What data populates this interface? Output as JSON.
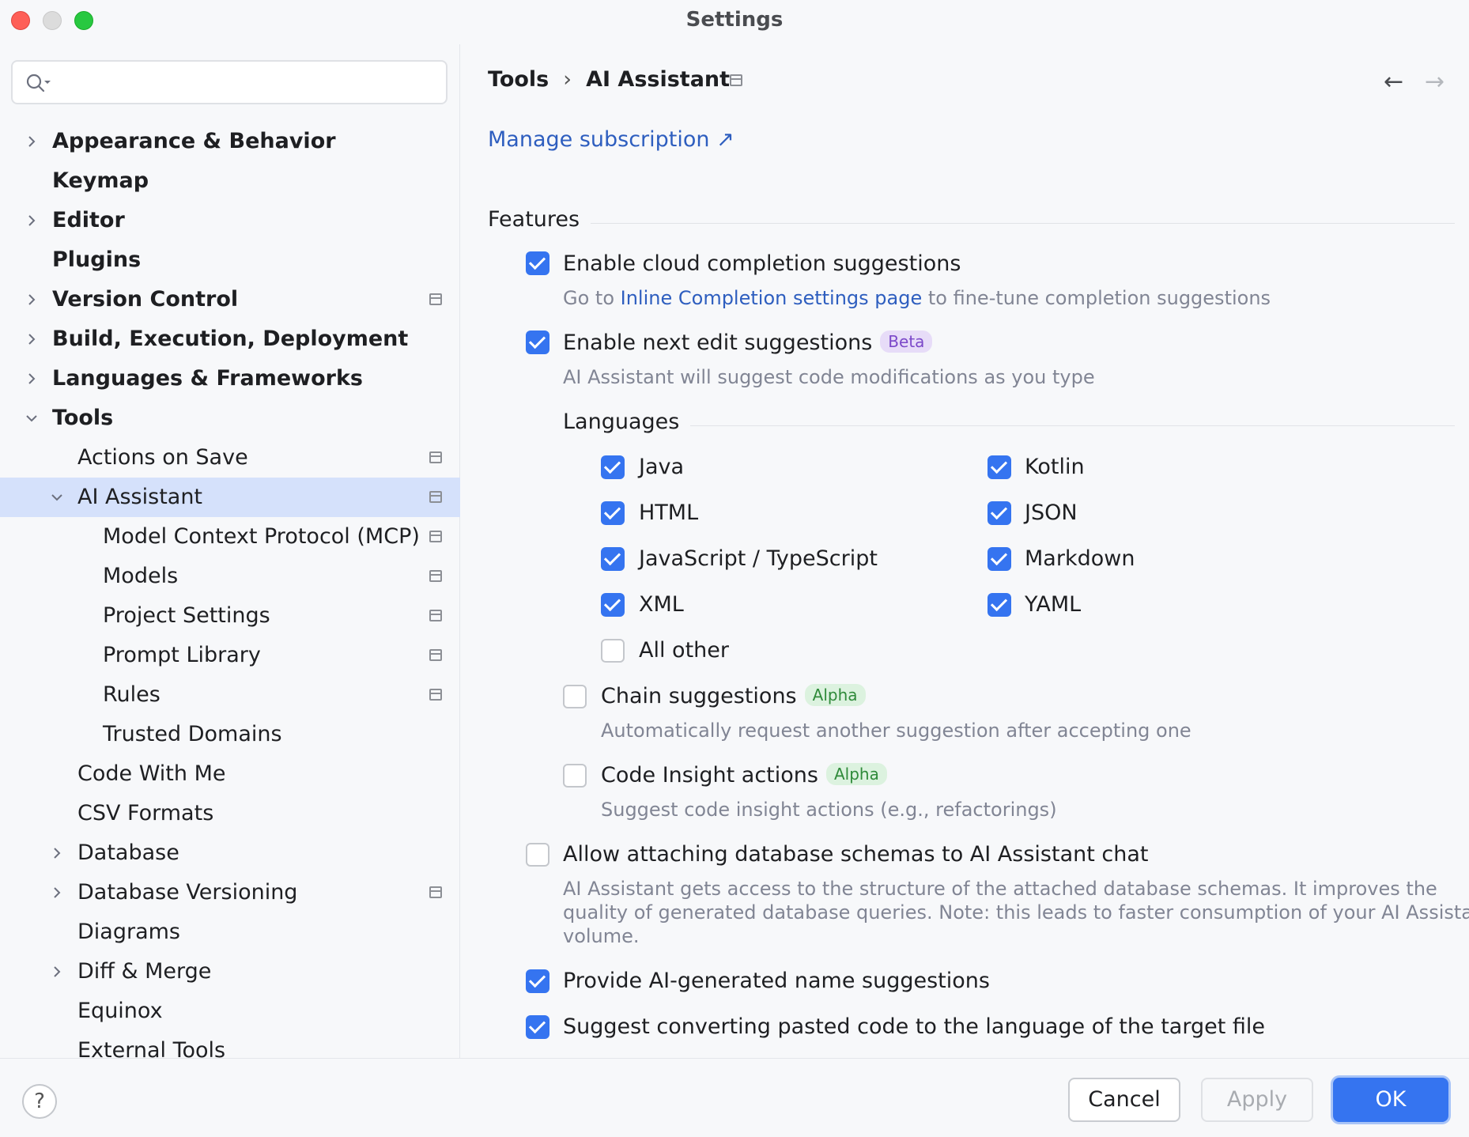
{
  "window": {
    "title": "Settings"
  },
  "sidebar": {
    "search_placeholder": "",
    "items": [
      {
        "label": "Appearance & Behavior",
        "bold": true,
        "level": 0,
        "chevron": "right",
        "pin": false
      },
      {
        "label": "Keymap",
        "bold": true,
        "level": 0,
        "chevron": "none",
        "pin": false
      },
      {
        "label": "Editor",
        "bold": true,
        "level": 0,
        "chevron": "right",
        "pin": false
      },
      {
        "label": "Plugins",
        "bold": true,
        "level": 0,
        "chevron": "none",
        "pin": false
      },
      {
        "label": "Version Control",
        "bold": true,
        "level": 0,
        "chevron": "right",
        "pin": true
      },
      {
        "label": "Build, Execution, Deployment",
        "bold": true,
        "level": 0,
        "chevron": "right",
        "pin": false
      },
      {
        "label": "Languages & Frameworks",
        "bold": true,
        "level": 0,
        "chevron": "right",
        "pin": false
      },
      {
        "label": "Tools",
        "bold": true,
        "level": 0,
        "chevron": "down",
        "pin": false
      },
      {
        "label": "Actions on Save",
        "bold": false,
        "level": 1,
        "chevron": "none",
        "pin": true
      },
      {
        "label": "AI Assistant",
        "bold": false,
        "level": 1,
        "chevron": "down",
        "pin": true,
        "selected": true
      },
      {
        "label": "Model Context Protocol (MCP)",
        "bold": false,
        "level": 2,
        "chevron": "none",
        "pin": true
      },
      {
        "label": "Models",
        "bold": false,
        "level": 2,
        "chevron": "none",
        "pin": true
      },
      {
        "label": "Project Settings",
        "bold": false,
        "level": 2,
        "chevron": "none",
        "pin": true
      },
      {
        "label": "Prompt Library",
        "bold": false,
        "level": 2,
        "chevron": "none",
        "pin": true
      },
      {
        "label": "Rules",
        "bold": false,
        "level": 2,
        "chevron": "none",
        "pin": true
      },
      {
        "label": "Trusted Domains",
        "bold": false,
        "level": 2,
        "chevron": "none",
        "pin": false
      },
      {
        "label": "Code With Me",
        "bold": false,
        "level": 1,
        "chevron": "none",
        "pin": false
      },
      {
        "label": "CSV Formats",
        "bold": false,
        "level": 1,
        "chevron": "none",
        "pin": false
      },
      {
        "label": "Database",
        "bold": false,
        "level": 1,
        "chevron": "right",
        "pin": false
      },
      {
        "label": "Database Versioning",
        "bold": false,
        "level": 1,
        "chevron": "right",
        "pin": true
      },
      {
        "label": "Diagrams",
        "bold": false,
        "level": 1,
        "chevron": "none",
        "pin": false
      },
      {
        "label": "Diff & Merge",
        "bold": false,
        "level": 1,
        "chevron": "right",
        "pin": false
      },
      {
        "label": "Equinox",
        "bold": false,
        "level": 1,
        "chevron": "none",
        "pin": false
      },
      {
        "label": "External Tools",
        "bold": false,
        "level": 1,
        "chevron": "none",
        "pin": false
      }
    ]
  },
  "main": {
    "breadcrumb": {
      "parent": "Tools",
      "separator": "›",
      "current": "AI Assistant"
    },
    "nav": {
      "back": "←",
      "forward": "→"
    },
    "manage_subscription": "Manage subscription ↗",
    "features": {
      "title": "Features",
      "cloud_completion": {
        "label": "Enable cloud completion suggestions",
        "checked": true,
        "hint_prefix": "Go to ",
        "hint_link": "Inline Completion settings page",
        "hint_suffix": " to fine-tune completion suggestions"
      },
      "next_edit": {
        "label": "Enable next edit suggestions",
        "checked": true,
        "badge": "Beta",
        "hint": "AI Assistant will suggest code modifications as you type"
      },
      "languages": {
        "title": "Languages",
        "java": {
          "label": "Java",
          "checked": true
        },
        "kotlin": {
          "label": "Kotlin",
          "checked": true
        },
        "html": {
          "label": "HTML",
          "checked": true
        },
        "json": {
          "label": "JSON",
          "checked": true
        },
        "js": {
          "label": "JavaScript / TypeScript",
          "checked": true
        },
        "markdown": {
          "label": "Markdown",
          "checked": true
        },
        "xml": {
          "label": "XML",
          "checked": true
        },
        "yaml": {
          "label": "YAML",
          "checked": true
        },
        "other": {
          "label": "All other",
          "checked": false
        }
      },
      "chain": {
        "label": "Chain suggestions",
        "checked": false,
        "badge": "Alpha",
        "hint": "Automatically request another suggestion after accepting one"
      },
      "code_insight": {
        "label": "Code Insight actions",
        "checked": false,
        "badge": "Alpha",
        "hint": "Suggest code insight actions (e.g., refactorings)"
      },
      "db_schemas": {
        "label": "Allow attaching database schemas to AI Assistant chat",
        "checked": false,
        "hint_line1": "AI Assistant gets access to the structure of the attached database schemas. It improves the",
        "hint_line2": "quality of generated database queries. Note: this leads to faster consumption of your AI Assistant",
        "hint_line3": "volume."
      },
      "name_suggestions": {
        "label": "Provide AI-generated name suggestions",
        "checked": true
      },
      "convert_pasted": {
        "label": "Suggest converting pasted code to the language of the target file",
        "checked": true
      }
    }
  },
  "footer": {
    "help": "?",
    "cancel": "Cancel",
    "apply": "Apply",
    "ok": "OK"
  },
  "colors": {
    "accent": "#3574f0",
    "link": "#2e5ebf",
    "selection": "#d5e1fb"
  }
}
